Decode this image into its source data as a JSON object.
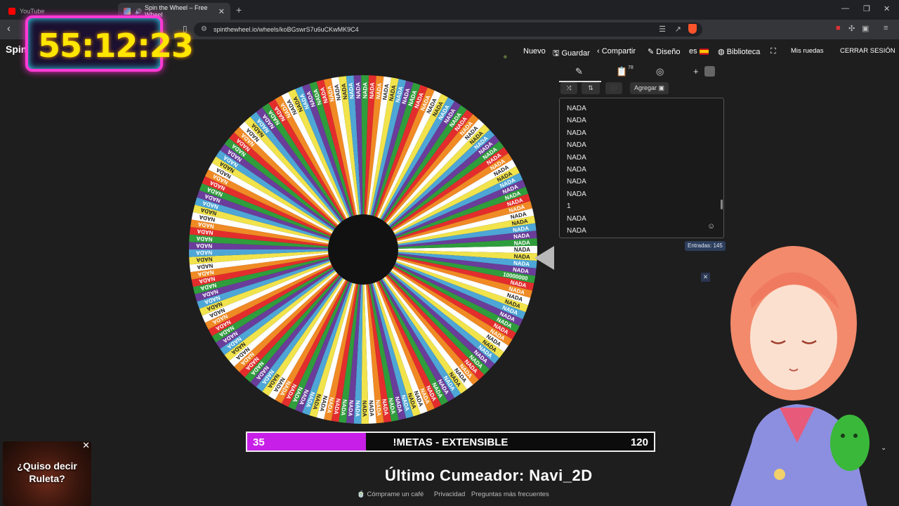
{
  "browser": {
    "tabs": [
      {
        "title": "YouTube",
        "active": false,
        "favicon_color": "#ff0000"
      },
      {
        "title": "Spin the Wheel – Free Wheel",
        "active": true,
        "favicon_color": "#8e44ad"
      }
    ],
    "url": "spinthewheel.io/wheels/koBGswrS7u6uCKwMK9C4"
  },
  "site": {
    "brand": "Spin Wheel",
    "menu": {
      "new": "Nuevo",
      "save": "Guardar",
      "share": "Compartir",
      "design": "Diseño",
      "lang": "es",
      "library": "Biblioteca",
      "my_wheels": "Mis ruedas",
      "logout": "CERRAR SESIÓN"
    }
  },
  "timer": {
    "value": "55:12:23"
  },
  "wheel": {
    "segment_label": "NADA",
    "highlight_label": "10000000",
    "segment_count": 145,
    "colors": [
      "#ffffff",
      "#f1e34b",
      "#4da6d6",
      "#6a3d9a",
      "#2f9d3c",
      "#e32d2d",
      "#f08a24"
    ],
    "hub_color": "#111111"
  },
  "panel": {
    "add_label": "Agregar",
    "list_badge": "78",
    "entries": [
      "NADA",
      "NADA",
      "NADA",
      "NADA",
      "NADA",
      "NADA",
      "NADA",
      "NADA",
      "1",
      "NADA",
      "NADA"
    ],
    "count_label": "Entradas: 145"
  },
  "goal_bar": {
    "current": "35",
    "label": "!METAS - EXTENSIBLE",
    "target": "120",
    "progress": 0.2917
  },
  "last_cum": "Último Cumeador: Navi_2D",
  "footer": {
    "links": [
      "Cómprame un café",
      "Privacidad",
      "Preguntas más frecuentes"
    ]
  },
  "ruleta_popup": {
    "text_line1": "¿Quiso decir",
    "text_line2": "Ruleta?"
  }
}
